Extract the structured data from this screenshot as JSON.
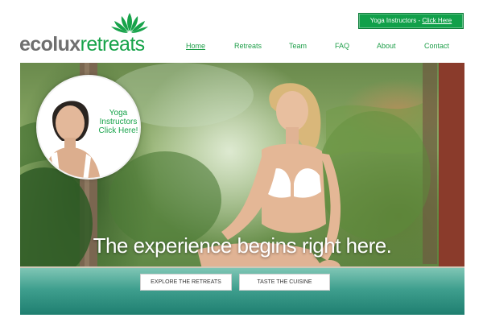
{
  "brand": {
    "eco": "ecolux",
    "retreats": "retreats"
  },
  "header": {
    "cta_prefix": "Yoga Instructors - ",
    "cta_link": "Click Here"
  },
  "nav": {
    "items": [
      {
        "label": "Home",
        "active": true
      },
      {
        "label": "Retreats",
        "active": false
      },
      {
        "label": "Team",
        "active": false
      },
      {
        "label": "FAQ",
        "active": false
      },
      {
        "label": "About",
        "active": false
      },
      {
        "label": "Contact",
        "active": false
      }
    ]
  },
  "hero": {
    "yoga_line1": "Yoga",
    "yoga_line2": "Instructors",
    "yoga_line3": "Click Here!",
    "tagline": "The experience begins right here.",
    "button_explore": "EXPLORE THE RETREATS",
    "button_cuisine": "TASTE THE CUISINE"
  },
  "colors": {
    "brand_green": "#17a34a",
    "logo_gray": "#6f6f6f",
    "cta_bg": "#11a04a"
  }
}
